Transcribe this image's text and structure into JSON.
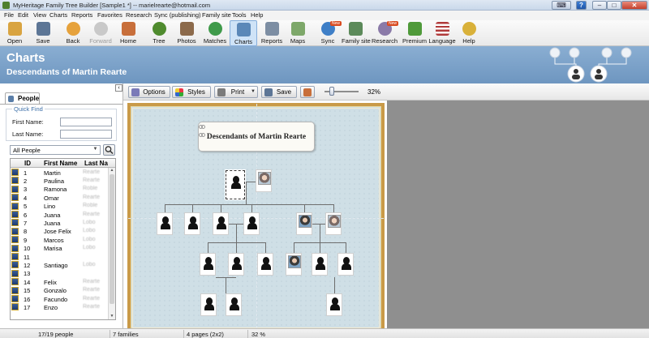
{
  "window": {
    "title": "MyHeritage Family Tree Builder [Sample1 *] -- marielrearte@hotmail.com"
  },
  "menu": [
    "File",
    "Edit",
    "View",
    "Charts",
    "Reports",
    "Favorites",
    "Research",
    "Sync (publishing)",
    "Family site",
    "Tools",
    "Help"
  ],
  "toolbar": {
    "items": [
      {
        "label": "Open",
        "icon": "open-folder-icon",
        "color": "#d9a441"
      },
      {
        "label": "Save",
        "icon": "save-disk-icon",
        "color": "#5d7696"
      },
      {
        "label": "Back",
        "icon": "back-arrow-icon",
        "color": "#e6a23c"
      },
      {
        "label": "Forward",
        "icon": "forward-arrow-icon",
        "color": "#c9c9c9"
      },
      {
        "label": "Home",
        "icon": "home-icon",
        "color": "#c86f3b"
      },
      {
        "label": "Tree",
        "icon": "tree-icon",
        "color": "#4f8b2e"
      },
      {
        "label": "Photos",
        "icon": "photos-icon",
        "color": "#8c6a4b"
      },
      {
        "label": "Matches",
        "icon": "matches-icon",
        "color": "#3f9a4a"
      },
      {
        "label": "Charts",
        "icon": "charts-icon",
        "color": "#5b88b8"
      },
      {
        "label": "Reports",
        "icon": "reports-icon",
        "color": "#7d8ea3"
      },
      {
        "label": "Maps",
        "icon": "maps-icon",
        "color": "#7ea86a"
      },
      {
        "label": "Sync",
        "icon": "sync-icon",
        "color": "#3f7fc7"
      },
      {
        "label": "Family site",
        "icon": "family-site-icon",
        "color": "#5c8a5a"
      },
      {
        "label": "Research",
        "icon": "research-icon",
        "color": "#8a7aa8"
      },
      {
        "label": "Premium",
        "icon": "premium-icon",
        "color": "#4f9a3a"
      },
      {
        "label": "Language",
        "icon": "language-flag-icon",
        "color": "#b03a3a"
      },
      {
        "label": "Help",
        "icon": "help-icon",
        "color": "#d9b13a"
      }
    ],
    "new_badge": "New"
  },
  "header": {
    "title": "Charts",
    "subtitle": "Descendants of Martin Rearte"
  },
  "left_panel": {
    "tab_label": "People",
    "quick_find": {
      "legend": "Quick Find",
      "first_name_label": "First Name:",
      "last_name_label": "Last Name:",
      "first_name_value": "",
      "last_name_value": ""
    },
    "filter_value": "All People",
    "table": {
      "columns": [
        "ID",
        "First Name",
        "Last Na"
      ],
      "rows": [
        {
          "id": "1",
          "first": "Martin",
          "last": "Rearte"
        },
        {
          "id": "2",
          "first": "Paulina",
          "last": "Rearte"
        },
        {
          "id": "3",
          "first": "Ramona",
          "last": "Roble"
        },
        {
          "id": "4",
          "first": "Omar",
          "last": "Rearte"
        },
        {
          "id": "5",
          "first": "Lino",
          "last": "Roble"
        },
        {
          "id": "6",
          "first": "Juana",
          "last": "Rearte"
        },
        {
          "id": "7",
          "first": "Juana",
          "last": "Lobo"
        },
        {
          "id": "8",
          "first": "Jose Felix",
          "last": "Lobo"
        },
        {
          "id": "9",
          "first": "Marcos",
          "last": "Lobo"
        },
        {
          "id": "10",
          "first": "Marisa",
          "last": "Lobo"
        },
        {
          "id": "11",
          "first": "",
          "last": ""
        },
        {
          "id": "12",
          "first": "Santiago",
          "last": "Lobo"
        },
        {
          "id": "13",
          "first": "",
          "last": ""
        },
        {
          "id": "14",
          "first": "Felix",
          "last": "Rearte"
        },
        {
          "id": "15",
          "first": "Gonzalo",
          "last": "Rearte"
        },
        {
          "id": "16",
          "first": "Facundo",
          "last": "Rearte"
        },
        {
          "id": "17",
          "first": "Enzo",
          "last": "Rearte"
        }
      ]
    }
  },
  "chart_toolbar": {
    "options_label": "Options",
    "styles_label": "Styles",
    "print_label": "Print",
    "save_label": "Save",
    "zoom_text": "32%"
  },
  "chart_page": {
    "title": "Descendants  of  Martin Rearte"
  },
  "status": {
    "people": "17/19 people",
    "families": "7 families",
    "pages": "4 pages (2x2)",
    "zoom": "32 %"
  }
}
